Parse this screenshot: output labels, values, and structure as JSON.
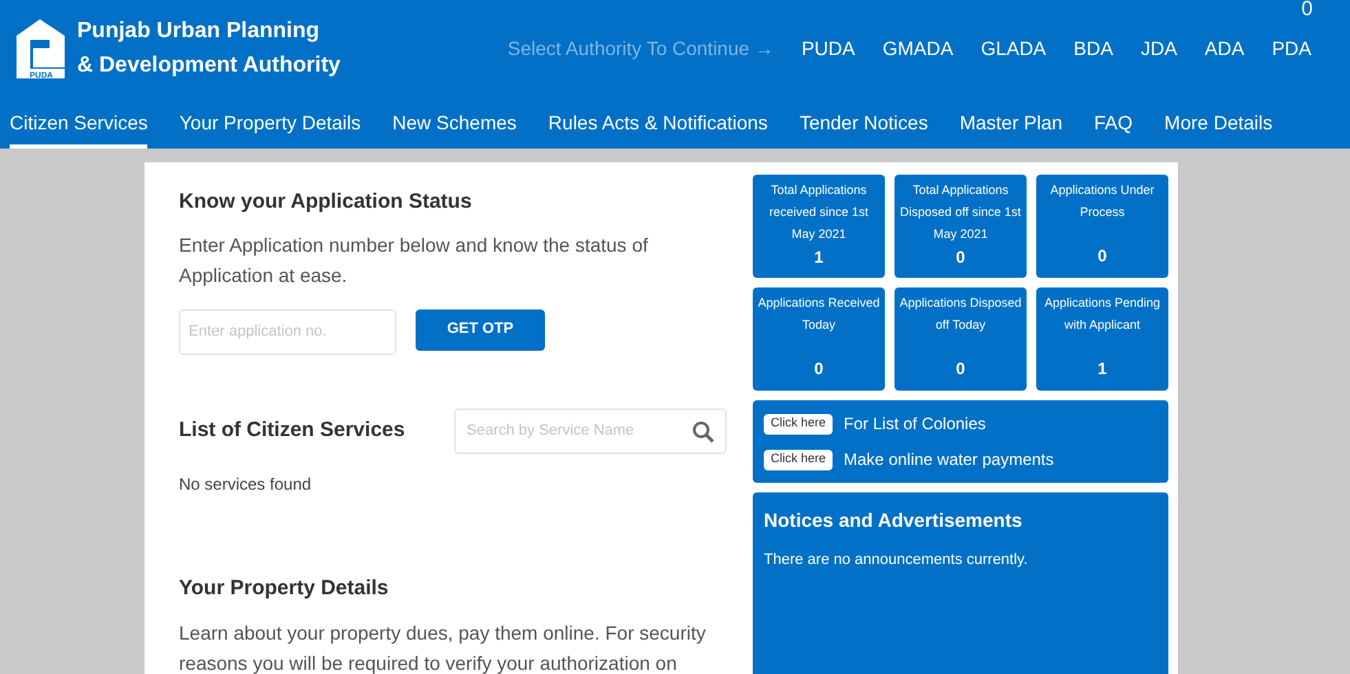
{
  "header": {
    "counter": "0",
    "title_lines": [
      "Punjab Urban Planning",
      "& Development Authority"
    ],
    "logo_text": "PUDA",
    "authority_prompt": "Select Authority To Continue →",
    "authorities": [
      "PUDA",
      "GMADA",
      "GLADA",
      "BDA",
      "JDA",
      "ADA",
      "PDA"
    ]
  },
  "nav": [
    {
      "label": "Citizen Services",
      "selected": true
    },
    {
      "label": "Your Property Details",
      "selected": false
    },
    {
      "label": "New Schemes",
      "selected": false
    },
    {
      "label": "Rules Acts & Notifications",
      "selected": false
    },
    {
      "label": "Tender Notices",
      "selected": false
    },
    {
      "label": "Master Plan",
      "selected": false
    },
    {
      "label": "FAQ",
      "selected": false
    },
    {
      "label": "More Details",
      "selected": false
    }
  ],
  "application_status": {
    "title": "Know your Application Status",
    "text": "Enter Application number below and know the status of Application at ease.",
    "input": {
      "placeholder": "Enter application no."
    },
    "button": "GET OTP"
  },
  "citizen_services": {
    "title": "List of Citizen Services",
    "search": {
      "placeholder": "Search by Service Name"
    },
    "empty": "No services found"
  },
  "property_details": {
    "title": "Your Property Details",
    "text": "Learn about your property dues, pay them online. For security reasons you will be required to verify your authorization on"
  },
  "stats": [
    {
      "label": "Total Applications received since 1st May 2021",
      "value": "1"
    },
    {
      "label": "Total Applications Disposed off since 1st May 2021",
      "value": "0"
    },
    {
      "label": "Applications Under Process",
      "value": "0"
    },
    {
      "label": "Applications Received Today",
      "value": "0"
    },
    {
      "label": "Applications Disposed off Today",
      "value": "0"
    },
    {
      "label": "Applications Pending with Applicant",
      "value": "1"
    }
  ],
  "quick_links": [
    {
      "button": "Click here",
      "text": "For List of Colonies"
    },
    {
      "button": "Click here",
      "text": "Make online water payments"
    }
  ],
  "notices": {
    "title": "Notices and Advertisements",
    "text": "There are no announcements currently."
  }
}
